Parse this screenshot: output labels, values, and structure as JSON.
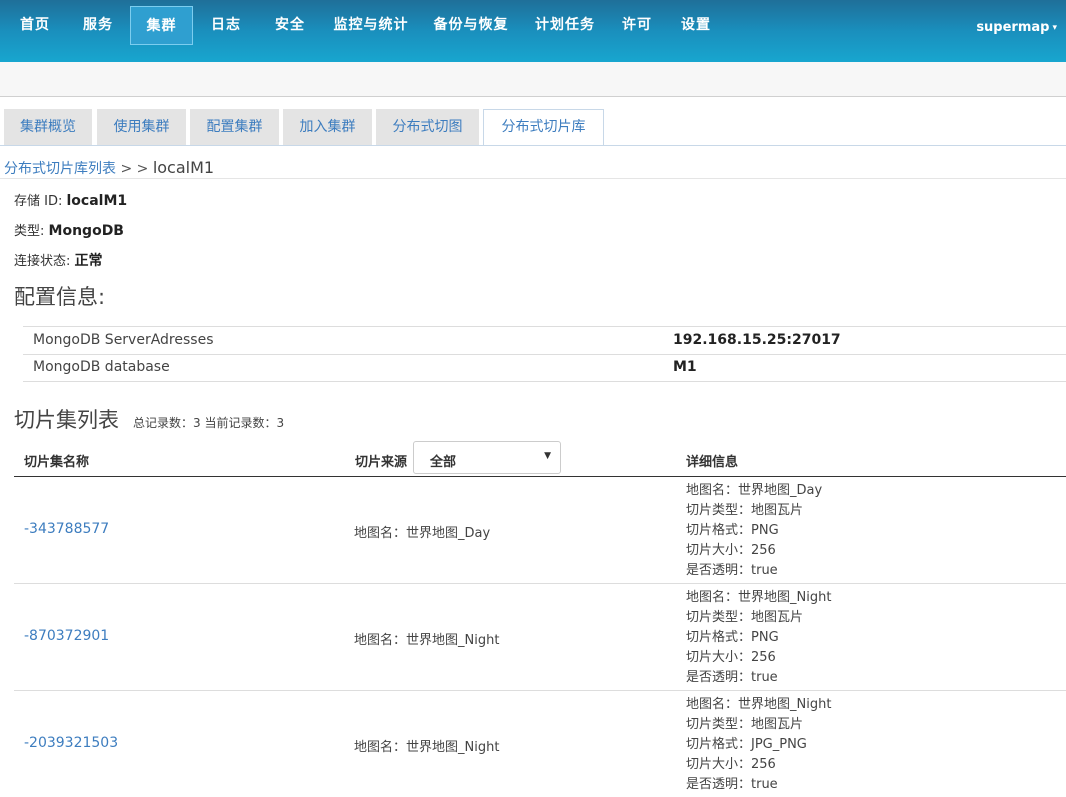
{
  "nav": {
    "items": [
      {
        "label": "首页"
      },
      {
        "label": "服务"
      },
      {
        "label": "集群"
      },
      {
        "label": "日志"
      },
      {
        "label": "安全"
      },
      {
        "label": "监控与统计"
      },
      {
        "label": "备份与恢复"
      },
      {
        "label": "计划任务"
      },
      {
        "label": "许可"
      },
      {
        "label": "设置"
      }
    ],
    "active_index": 2,
    "user": "supermap",
    "user_caret": "▾"
  },
  "tabs": {
    "items": [
      {
        "label": "集群概览"
      },
      {
        "label": "使用集群"
      },
      {
        "label": "配置集群"
      },
      {
        "label": "加入集群"
      },
      {
        "label": "分布式切图"
      },
      {
        "label": "分布式切片库"
      }
    ],
    "active_index": 5
  },
  "breadcrumb": {
    "link": "分布式切片库列表",
    "separator": " > > ",
    "current": "localM1"
  },
  "info": {
    "store_id_label": "存储 ID:",
    "store_id": "localM1",
    "type_label": "类型:",
    "type": "MongoDB",
    "status_label": "连接状态:",
    "status": "正常"
  },
  "config": {
    "title": "配置信息:",
    "rows": [
      {
        "key": "MongoDB ServerAdresses",
        "value": "192.168.15.25:27017"
      },
      {
        "key": "MongoDB database",
        "value": "M1"
      }
    ]
  },
  "tilesets": {
    "title": "切片集列表",
    "count_text": "总记录数：3  当前记录数：3",
    "columns": {
      "name": "切片集名称",
      "source": "切片来源",
      "details": "详细信息"
    },
    "source_filter": "全部",
    "rows": [
      {
        "id": "-343788577",
        "source": "地图名：世界地图_Day",
        "details": [
          "地图名：世界地图_Day",
          "切片类型：地图瓦片",
          "切片格式：PNG",
          "切片大小：256",
          "是否透明：true"
        ]
      },
      {
        "id": "-870372901",
        "source": "地图名：世界地图_Night",
        "details": [
          "地图名：世界地图_Night",
          "切片类型：地图瓦片",
          "切片格式：PNG",
          "切片大小：256",
          "是否透明：true"
        ]
      },
      {
        "id": "-2039321503",
        "source": "地图名：世界地图_Night",
        "details": [
          "地图名：世界地图_Night",
          "切片类型：地图瓦片",
          "切片格式：JPG_PNG",
          "切片大小：256",
          "是否透明：true"
        ]
      }
    ]
  },
  "colors": {
    "nav_gradient_top": "#1f6f99",
    "nav_gradient_bottom": "#18a6cf",
    "link": "#3d7dbf",
    "tab_bg": "#e4e4e4"
  },
  "icons": {
    "select_arrow": "caret-down-icon"
  }
}
